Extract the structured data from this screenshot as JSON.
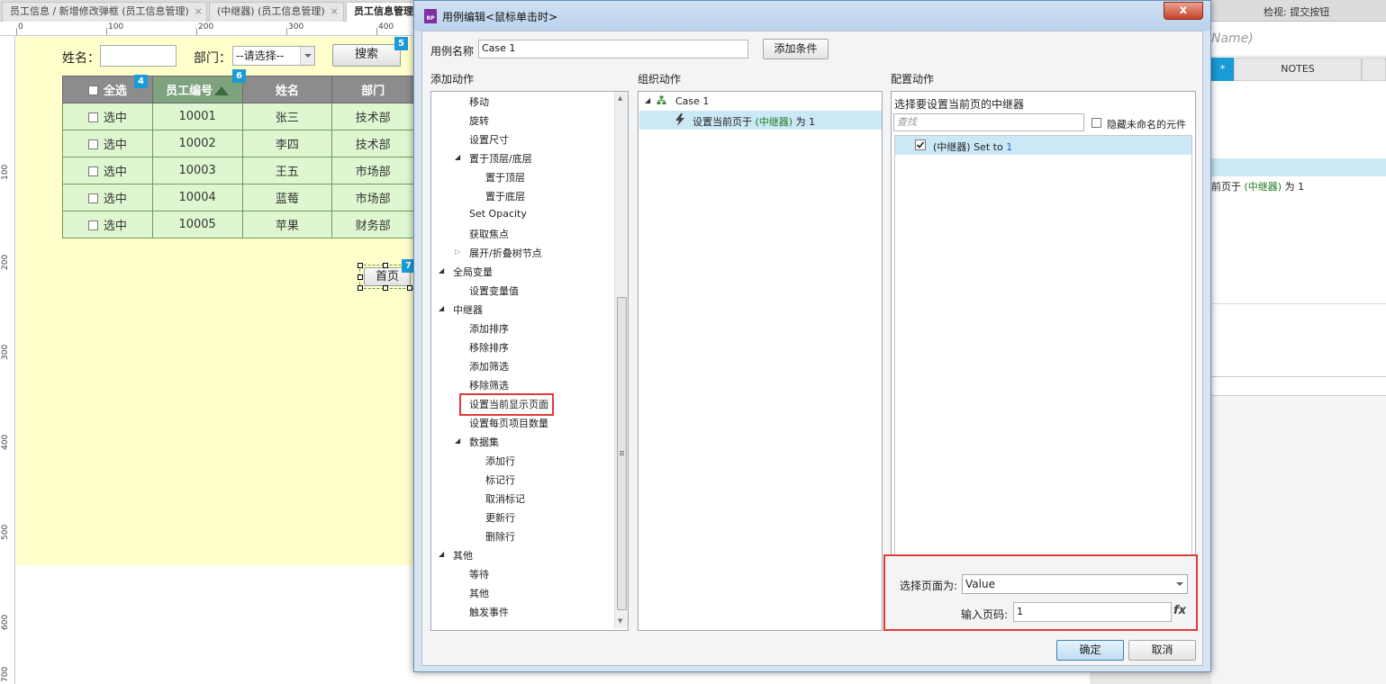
{
  "tabs": [
    {
      "label": "员工信息 / 新增修改弹框 (员工信息管理)",
      "close": "×"
    },
    {
      "label": "(中继器) (员工信息管理)",
      "close": "×"
    },
    {
      "label": "员工信息管理",
      "close": ""
    }
  ],
  "ruler": {
    "top": [
      "0",
      "100",
      "200",
      "300",
      "400"
    ],
    "left": [
      "100",
      "200",
      "300",
      "400",
      "500",
      "600",
      "700"
    ]
  },
  "canvas": {
    "name_label": "姓名：",
    "dept_label": "部门：",
    "dept_select": "--请选择--",
    "search_button": "搜索",
    "badges": [
      "5",
      "4",
      "6",
      "7"
    ],
    "table": {
      "headers": [
        "全选",
        "员工编号",
        "姓名",
        "部门"
      ],
      "rows": [
        {
          "check": "选中",
          "id": "10001",
          "name": "张三",
          "dept": "技术部"
        },
        {
          "check": "选中",
          "id": "10002",
          "name": "李四",
          "dept": "技术部"
        },
        {
          "check": "选中",
          "id": "10003",
          "name": "王五",
          "dept": "市场部"
        },
        {
          "check": "选中",
          "id": "10004",
          "name": "蓝莓",
          "dept": "市场部"
        },
        {
          "check": "选中",
          "id": "10005",
          "name": "苹果",
          "dept": "财务部"
        }
      ]
    },
    "home_button": "首页"
  },
  "right_panel": {
    "title": "检视: 提交按钮",
    "name_placeholder": "Name)",
    "tab_star": "*",
    "tab_notes": "NOTES",
    "action_prefix": "前页于 ",
    "action_target": "(中继器)",
    "action_suffix": " 为 1"
  },
  "dialog": {
    "title": "用例编辑<鼠标单击时>",
    "close": "x",
    "case_name_label": "用例名称",
    "case_name_value": "Case 1",
    "add_condition": "添加条件",
    "col_add_action": "添加动作",
    "col_organize": "组织动作",
    "col_configure": "配置动作",
    "actions": [
      {
        "label": "移动",
        "level": 1
      },
      {
        "label": "旋转",
        "level": 1
      },
      {
        "label": "设置尺寸",
        "level": 1
      },
      {
        "label": "置于顶层/底层",
        "level": 1,
        "toggle": "open"
      },
      {
        "label": "置于顶层",
        "level": 2
      },
      {
        "label": "置于底层",
        "level": 2
      },
      {
        "label": "Set Opacity",
        "level": 1
      },
      {
        "label": "获取焦点",
        "level": 1
      },
      {
        "label": "展开/折叠树节点",
        "level": 1,
        "toggle": "closed"
      },
      {
        "label": "全局变量",
        "level": 0,
        "toggle": "open"
      },
      {
        "label": "设置变量值",
        "level": 1
      },
      {
        "label": "中继器",
        "level": 0,
        "toggle": "open"
      },
      {
        "label": "添加排序",
        "level": 1
      },
      {
        "label": "移除排序",
        "level": 1
      },
      {
        "label": "添加筛选",
        "level": 1
      },
      {
        "label": "移除筛选",
        "level": 1
      },
      {
        "label": "设置当前显示页面",
        "level": 1
      },
      {
        "label": "设置每页项目数量",
        "level": 1
      },
      {
        "label": "数据集",
        "level": 1,
        "toggle": "open"
      },
      {
        "label": "添加行",
        "level": 2
      },
      {
        "label": "标记行",
        "level": 2
      },
      {
        "label": "取消标记",
        "level": 2
      },
      {
        "label": "更新行",
        "level": 2
      },
      {
        "label": "删除行",
        "level": 2
      },
      {
        "label": "其他",
        "level": 0,
        "toggle": "open"
      },
      {
        "label": "等待",
        "level": 1
      },
      {
        "label": "其他",
        "level": 1
      },
      {
        "label": "触发事件",
        "level": 1
      }
    ],
    "organize": {
      "case_label": "Case 1",
      "action_prefix": "设置当前页于 ",
      "action_target": "(中继器)",
      "action_suffix": " 为 1"
    },
    "configure": {
      "heading": "选择要设置当前页的中继器",
      "search_placeholder": "查找",
      "hide_unnamed": "隐藏未命名的元件",
      "target_prefix": "(中继器) Set to ",
      "target_value": "1",
      "page_select_label": "选择页面为:",
      "page_select_value": "Value",
      "page_input_label": "输入页码:",
      "page_input_value": "1",
      "fx": "fx"
    },
    "ok": "确定",
    "cancel": "取消"
  }
}
